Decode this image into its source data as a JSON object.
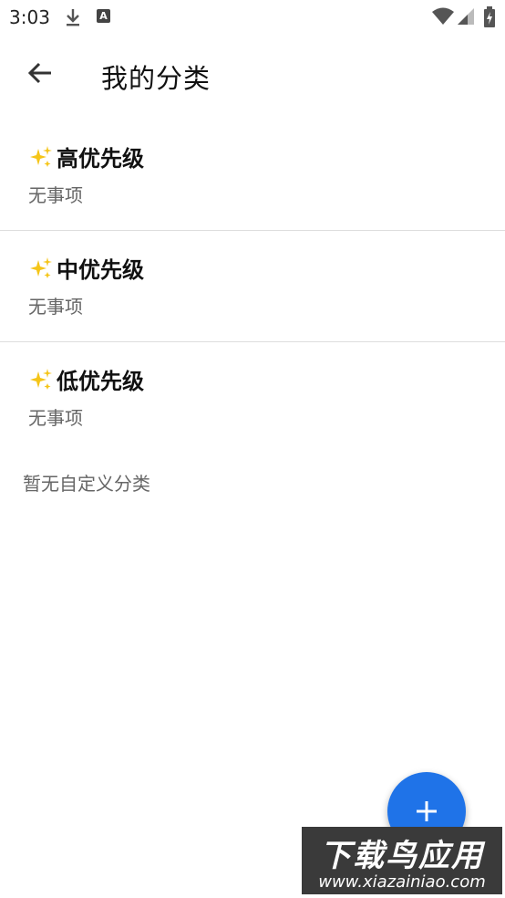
{
  "status_bar": {
    "time": "3:03",
    "icons": [
      "download-icon",
      "a-icon",
      "wifi-icon",
      "signal-icon",
      "battery-icon"
    ],
    "a_icon_letter": "A"
  },
  "toolbar": {
    "title": "我的分类",
    "back_icon": "arrow-left-icon"
  },
  "categories": [
    {
      "icon": "sparkles-icon",
      "title": "高优先级",
      "subtitle": "无事项"
    },
    {
      "icon": "sparkles-icon",
      "title": "中优先级",
      "subtitle": "无事项"
    },
    {
      "icon": "sparkles-icon",
      "title": "低优先级",
      "subtitle": "无事项"
    }
  ],
  "empty_custom": "暂无自定义分类",
  "fab": {
    "icon": "plus-icon"
  },
  "watermark": {
    "main": "下载鸟应用",
    "sub": "www.xiazainiao.com"
  },
  "colors": {
    "accent": "#1f73e8",
    "sparkle": "#f5c518",
    "muted_text": "#666666",
    "divider": "#dedede"
  }
}
